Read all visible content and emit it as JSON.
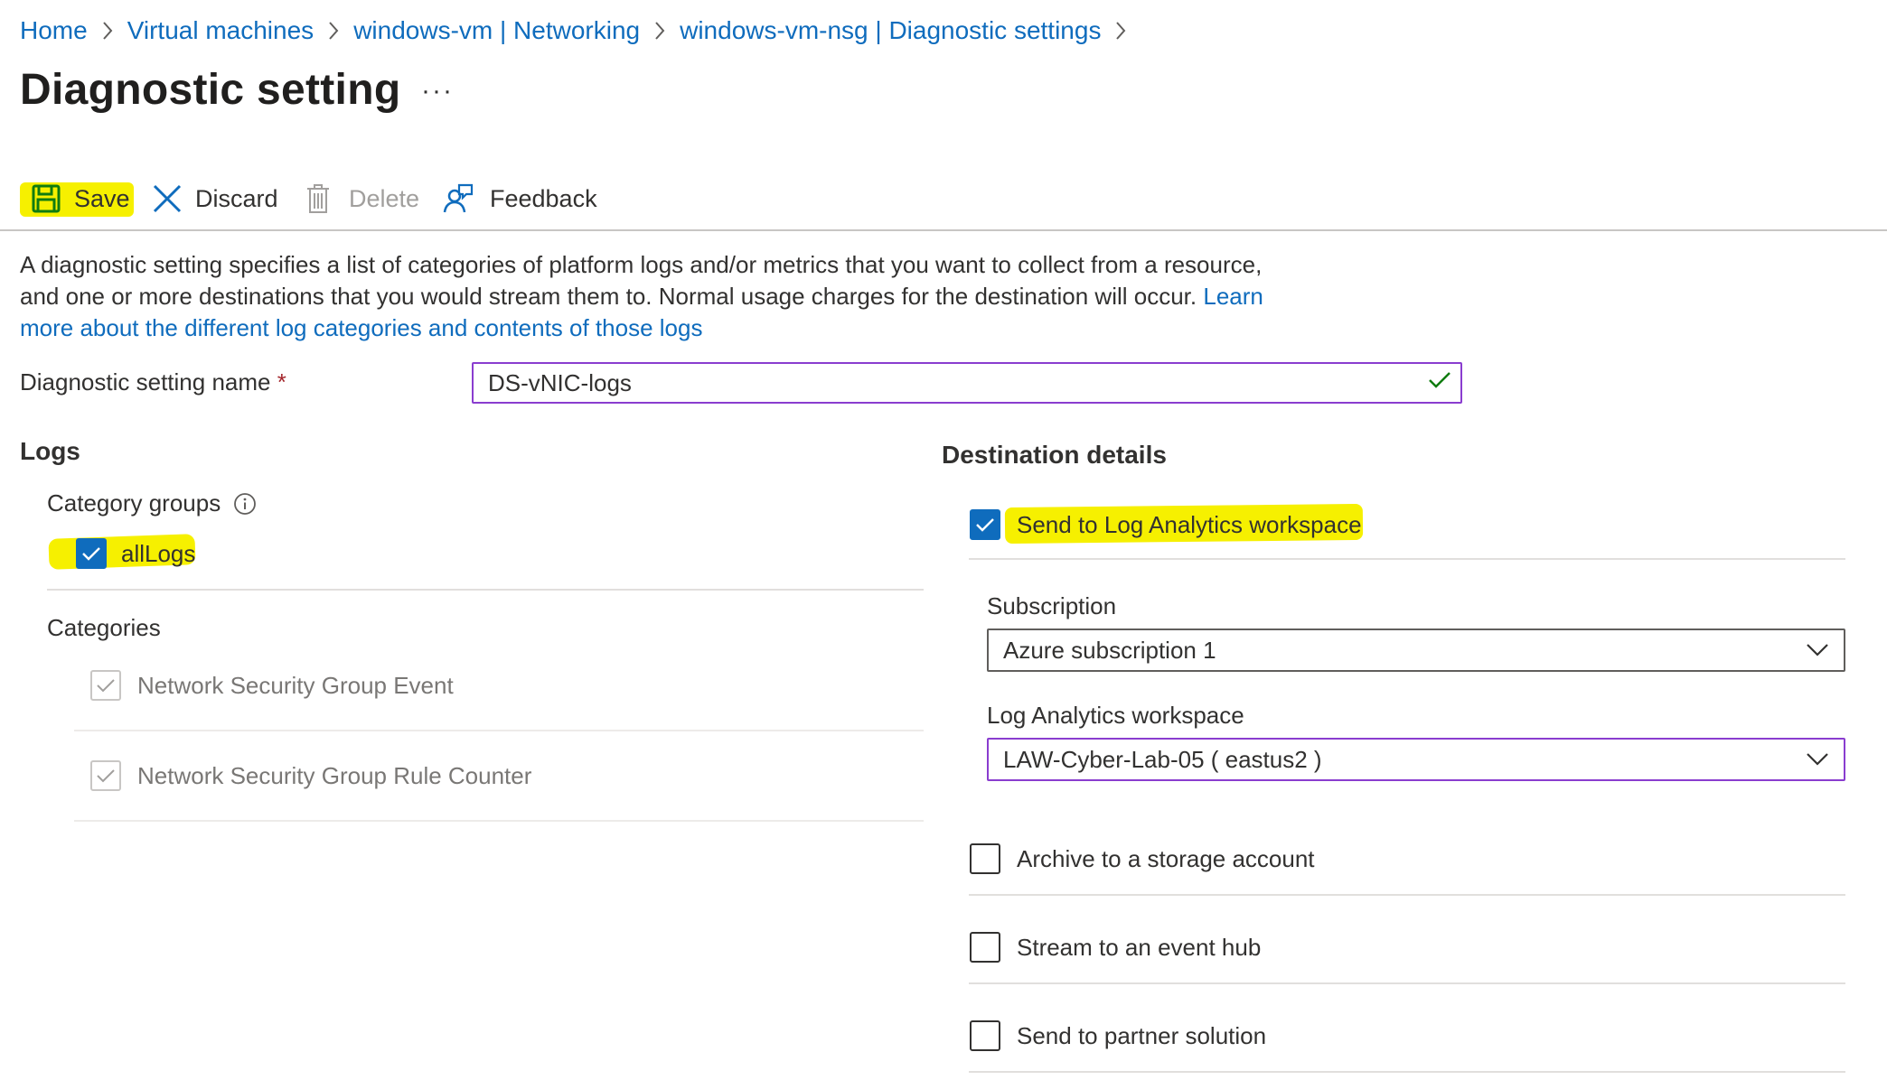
{
  "breadcrumb": [
    "Home",
    "Virtual machines",
    "windows-vm | Networking",
    "windows-vm-nsg | Diagnostic settings"
  ],
  "page_title": "Diagnostic setting",
  "more_label": "···",
  "toolbar": {
    "save": "Save",
    "discard": "Discard",
    "delete": "Delete",
    "feedback": "Feedback"
  },
  "description": {
    "text": "A diagnostic setting specifies a list of categories of platform logs and/or metrics that you want to collect from a resource, and one or more destinations that you would stream them to. Normal usage charges for the destination will occur. ",
    "link": "Learn more about the different log categories and contents of those logs"
  },
  "setting_name": {
    "label": "Diagnostic setting name",
    "required_mark": "*",
    "value": "DS-vNIC-logs"
  },
  "logs": {
    "heading": "Logs",
    "category_groups_label": "Category groups",
    "all_logs": {
      "label": "allLogs",
      "checked": true
    },
    "categories_label": "Categories",
    "categories": [
      {
        "label": "Network Security Group Event",
        "checked": true,
        "disabled": true
      },
      {
        "label": "Network Security Group Rule Counter",
        "checked": true,
        "disabled": true
      }
    ]
  },
  "destination": {
    "heading": "Destination details",
    "log_analytics": {
      "label": "Send to Log Analytics workspace",
      "checked": true
    },
    "subscription_label": "Subscription",
    "subscription_value": "Azure subscription 1",
    "workspace_label": "Log Analytics workspace",
    "workspace_value": "LAW-Cyber-Lab-05 ( eastus2 )",
    "archive": {
      "label": "Archive to a storage account",
      "checked": false
    },
    "event_hub": {
      "label": "Stream to an event hub",
      "checked": false
    },
    "partner": {
      "label": "Send to partner solution",
      "checked": false
    }
  },
  "colors": {
    "link": "#0f6cbd",
    "highlight": "#f6f000",
    "focus_border": "#8a3dcf",
    "checkbox_checked": "#0f6cbd",
    "valid_check": "#107c10"
  }
}
